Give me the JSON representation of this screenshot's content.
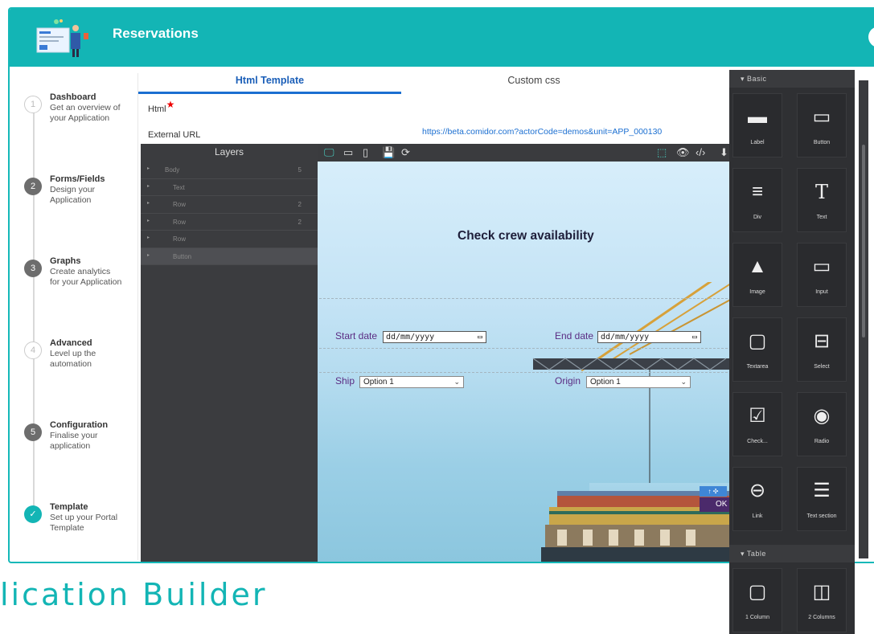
{
  "app": {
    "title": "Reservations"
  },
  "steps": [
    {
      "num": "1",
      "title": "Dashboard",
      "desc": "Get an overview of your Application",
      "state": "pending"
    },
    {
      "num": "2",
      "title": "Forms/Fields",
      "desc": "Design your Application",
      "state": "active"
    },
    {
      "num": "3",
      "title": "Graphs",
      "desc": "Create analytics for your Application",
      "state": "active"
    },
    {
      "num": "4",
      "title": "Advanced",
      "desc": "Level up the automation",
      "state": "pending"
    },
    {
      "num": "5",
      "title": "Configuration",
      "desc": "Finalise your application",
      "state": "active"
    },
    {
      "num": "✓",
      "title": "Template",
      "desc": "Set up your Portal Template",
      "state": "done"
    }
  ],
  "tabs": {
    "html": "Html Template",
    "css": "Custom css"
  },
  "fields": {
    "html_label": "Html",
    "required_mark": "★",
    "external_url_label": "External URL",
    "external_url": "https://beta.comidor.com?actorCode=demos&unit=APP_000130"
  },
  "layers": {
    "title": "Layers",
    "rows": [
      {
        "name": "Body",
        "count": "5"
      },
      {
        "name": "Text",
        "count": ""
      },
      {
        "name": "Row",
        "count": "2"
      },
      {
        "name": "Row",
        "count": "2"
      },
      {
        "name": "Row",
        "count": ""
      },
      {
        "name": "Button",
        "count": ""
      }
    ]
  },
  "canvas": {
    "heading": "Check crew availability",
    "start_label": "Start date",
    "end_label": "End date",
    "date_placeholder": "dd/mm/yyyy",
    "ship_label": "Ship",
    "origin_label": "Origin",
    "ship_value": "Option 1",
    "origin_value": "Option 1",
    "ok_label": "OK"
  },
  "blocks_panel": {
    "basic_title": "Basic",
    "table_title": "Table",
    "basic": [
      {
        "label": "Label",
        "icon": "label-icon"
      },
      {
        "label": "Button",
        "icon": "button-icon"
      },
      {
        "label": "Div",
        "icon": "div-icon"
      },
      {
        "label": "Text",
        "icon": "text-icon"
      },
      {
        "label": "Image",
        "icon": "image-icon"
      },
      {
        "label": "Input",
        "icon": "input-icon"
      },
      {
        "label": "Textarea",
        "icon": "textarea-icon"
      },
      {
        "label": "Select",
        "icon": "select-icon"
      },
      {
        "label": "Check...",
        "icon": "checkbox-icon"
      },
      {
        "label": "Radio",
        "icon": "radio-icon"
      },
      {
        "label": "Link",
        "icon": "link-icon"
      },
      {
        "label": "Text section",
        "icon": "text-section-icon"
      }
    ],
    "table": [
      {
        "label": "1 Column",
        "icon": "one-column-icon"
      },
      {
        "label": "2 Columns",
        "icon": "two-columns-icon"
      }
    ]
  },
  "footer_title": "lication Builder",
  "colors": {
    "brand": "#13b5b5",
    "link": "#1b6fd1",
    "form_label": "#5b2c83"
  }
}
